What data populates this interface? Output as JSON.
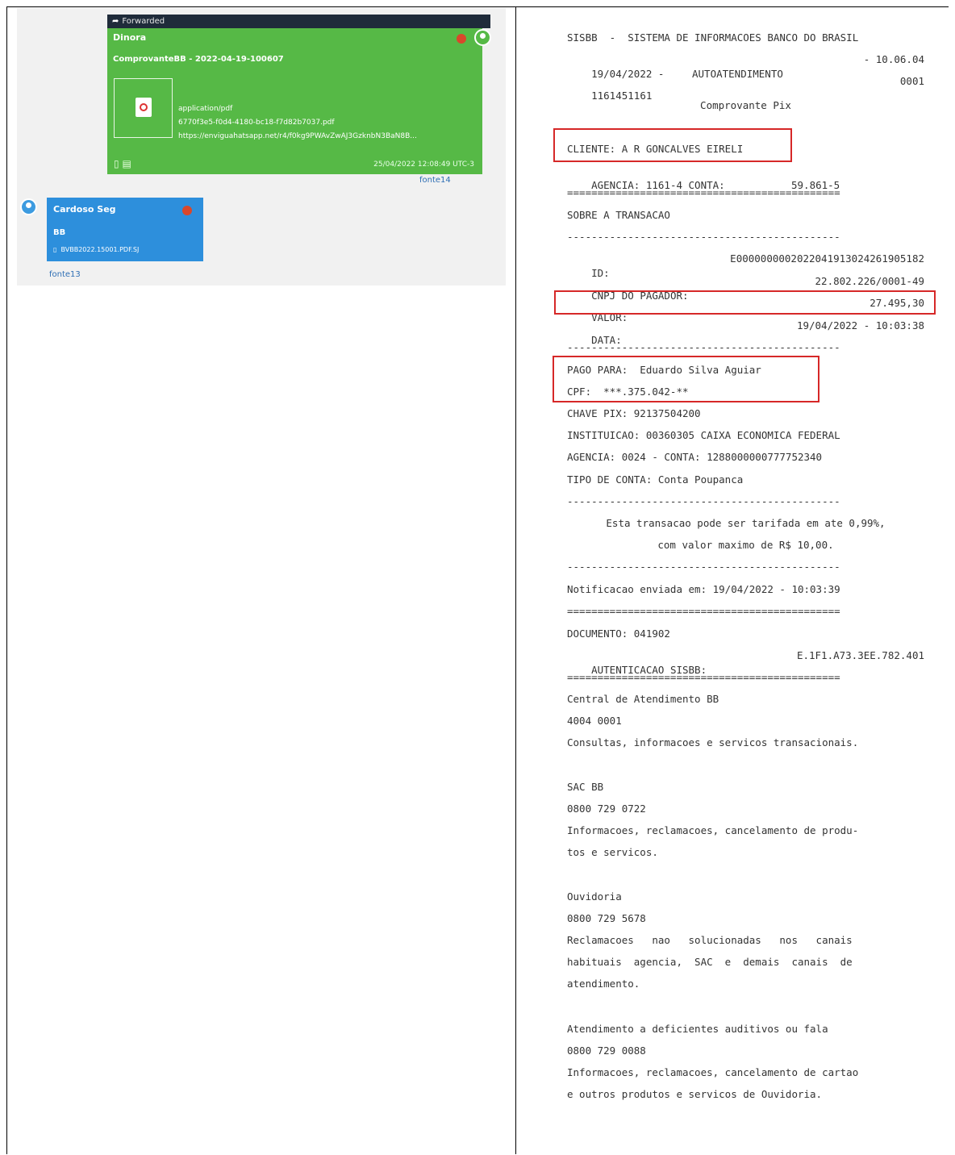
{
  "chat": {
    "forwarded_label": "Forwarded",
    "msg1": {
      "sender": "Dinora",
      "title": "ComprovanteBB - 2022-04-19-100607",
      "file_type": "application/pdf",
      "file_name": "6770f3e5-f0d4-4180-bc18-f7d82b7037.pdf",
      "file_url": "https://enviguahatsapp.net/r4/f0kg9PWAvZwAJ3GzknbN3BaN8B...",
      "timestamp": "25/04/2022 12:08:49 UTC-3",
      "link": "fonte14"
    },
    "msg2": {
      "sender": "Cardoso Seg",
      "body": "BB",
      "file": "BVBB2022.15001.PDF.SJ",
      "link": "fonte13"
    }
  },
  "receipt": {
    "header1": "SISBB  -  SISTEMA DE INFORMACOES BANCO DO BRASIL",
    "header2_left": "19/04/2022 -",
    "header2_mid": "AUTOATENDIMENTO",
    "header2_right": "- 10.06.04",
    "header3_left": "1161451161",
    "header3_right": "0001",
    "doc_title": "Comprovante Pix",
    "cliente": "CLIENTE: A R GONCALVES EIRELI",
    "agencia_label": "AGENCIA: 1161-4 CONTA:",
    "agencia_value": "59.861-5",
    "sep_eq": "=============================================",
    "sobre": "SOBRE A TRANSACAO",
    "sep_dash": "---------------------------------------------",
    "id_label": "ID:",
    "id_value": "E0000000002022041913024261905182",
    "cnpj_label": "CNPJ DO PAGADOR:",
    "cnpj_value": "22.802.226/0001-49",
    "valor_label": "VALOR:",
    "valor_value": "27.495,30",
    "data_label": "DATA:",
    "data_value": "19/04/2022 - 10:03:38",
    "pago_para": "PAGO PARA:  Eduardo Silva Aguiar",
    "cpf": "CPF:  ***.375.042-**",
    "chave_pix": "CHAVE PIX: 92137504200",
    "instituicao": "INSTITUICAO: 00360305 CAIXA ECONOMICA FEDERAL",
    "agencia_dest": "AGENCIA: 0024 - CONTA: 1288000000777752340",
    "tipo_conta": "TIPO DE CONTA: Conta Poupanca",
    "tarifa1": "Esta transacao pode ser tarifada em ate 0,99%,",
    "tarifa2": "com valor maximo de R$ 10,00.",
    "notificacao": "Notificacao enviada em: 19/04/2022 - 10:03:39",
    "documento": "DOCUMENTO: 041902",
    "autenticacao_label": "AUTENTICACAO SISBB:",
    "autenticacao_value": "E.1F1.A73.3EE.782.401",
    "central_title": "Central de Atendimento BB",
    "central_phone": "4004 0001",
    "central_desc": "Consultas, informacoes e servicos transacionais.",
    "sac_title": "SAC BB",
    "sac_phone": "0800 729 0722",
    "sac_desc1": "Informacoes, reclamacoes, cancelamento de produ-",
    "sac_desc2": "tos e servicos.",
    "ouv_title": "Ouvidoria",
    "ouv_phone": "0800 729 5678",
    "ouv_desc1": "Reclamacoes   nao   solucionadas   nos   canais",
    "ouv_desc2": "habituais  agencia,  SAC  e  demais  canais  de",
    "ouv_desc3": "atendimento.",
    "def_title": "Atendimento a deficientes auditivos ou fala",
    "def_phone": "0800 729 0088",
    "def_desc1": "Informacoes, reclamacoes, cancelamento de cartao",
    "def_desc2": "e outros produtos e servicos de Ouvidoria."
  },
  "colors": {
    "green_bubble": "#56b946",
    "blue_bubble": "#2d8fdc",
    "highlight": "#d62828"
  }
}
